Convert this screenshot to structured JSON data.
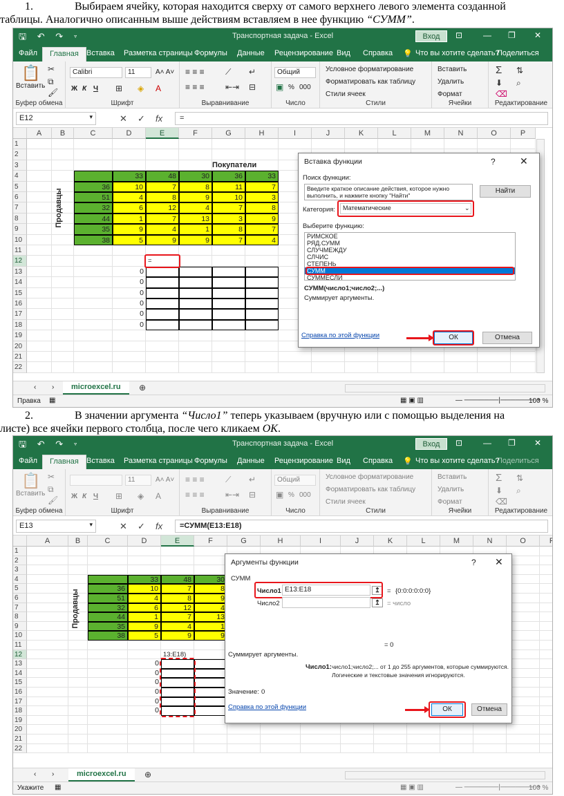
{
  "text1": {
    "num": "1.",
    "line1": "Выбираем ячейку, которая находится сверху от самого верхнего левого элемента созданной",
    "line2_pre": "таблицы. Аналогично описанным выше действиям вставляем в нее функцию ",
    "line2_fn": "“СУММ”",
    "line2_post": "."
  },
  "text2": {
    "num": "2.",
    "line1_pre": "В значении аргумента ",
    "line1_arg": "“Число1”",
    "line1_post": " теперь указываем (вручную или с помощью выделения на",
    "line2_pre": "листе) все ячейки первого столбца, после чего кликаем ",
    "line2_ok": "OK",
    "line2_post": "."
  },
  "window": {
    "title": "Транспортная задача - Excel",
    "login": "Вход",
    "qat": "🖫 ↶ ↷ ▿",
    "min": "—",
    "restore": "❐",
    "close": "✕",
    "ribbon_opts": "⊡"
  },
  "tabs": [
    "Файл",
    "Главная",
    "Вставка",
    "Разметка страницы",
    "Формулы",
    "Данные",
    "Рецензирование",
    "Вид",
    "Справка",
    "Что вы хотите сделать?",
    "Поделиться"
  ],
  "ribbon": {
    "paste": "Вставить",
    "clipboard": "Буфер обмена",
    "font": "Шрифт",
    "font_name": "Calibri",
    "font_size": "11",
    "alignment": "Выравнивание",
    "number": "Число",
    "number_format": "Общий",
    "cond_format": "Условное форматирование",
    "format_table": "Форматировать как таблицу",
    "cell_styles": "Стили ячеек",
    "styles": "Стили",
    "insert": "Вставить",
    "delete": "Удалить",
    "format": "Формат",
    "cells": "Ячейки",
    "editing": "Редактирование",
    "bold": "Ж",
    "italic": "К",
    "underline": "Ч",
    "percent": "%",
    "thousands": "000",
    "sigma": "Σ"
  },
  "shot1": {
    "cell_ref": "E12",
    "formula": "=",
    "mode": "Правка",
    "zoom": "100 %"
  },
  "shot2": {
    "cell_ref": "E13",
    "formula": "=СУММ(E13:E18)",
    "mode": "Укажите",
    "zoom": "100 %"
  },
  "columns": [
    "A",
    "B",
    "C",
    "D",
    "E",
    "F",
    "G",
    "H",
    "I",
    "J",
    "K",
    "L",
    "M",
    "N",
    "O",
    "P"
  ],
  "rows": [
    "1",
    "2",
    "3",
    "4",
    "5",
    "6",
    "7",
    "8",
    "9",
    "10",
    "11",
    "12",
    "13",
    "14",
    "15",
    "16",
    "17",
    "18",
    "19",
    "20",
    "21",
    "22"
  ],
  "sheet": {
    "tab": "microexcel.ru",
    "buyers": "Покупатели",
    "sellers": "Продавцы",
    "header_row": [
      "33",
      "48",
      "30",
      "36",
      "33"
    ],
    "supply": [
      "36",
      "51",
      "32",
      "44",
      "35",
      "38"
    ],
    "matrix": [
      [
        "10",
        "7",
        "8",
        "11",
        "7"
      ],
      [
        "4",
        "8",
        "9",
        "10",
        "3"
      ],
      [
        "6",
        "12",
        "4",
        "7",
        "8"
      ],
      [
        "1",
        "7",
        "13",
        "3",
        "9"
      ],
      [
        "9",
        "4",
        "1",
        "8",
        "7"
      ],
      [
        "5",
        "9",
        "9",
        "7",
        "4"
      ]
    ],
    "zeros": [
      "0",
      "0",
      "0",
      "0",
      "0",
      "0"
    ],
    "e12_1": "=",
    "e12_2": "13:E18)"
  },
  "dialog1": {
    "title": "Вставка функции",
    "help": "?",
    "close": "✕",
    "search_label": "Поиск функции:",
    "search_text": "Введите краткое описание действия, которое нужно выполнить, и нажмите кнопку \"Найти\"",
    "find": "Найти",
    "category_label": "Категория:",
    "category": "Математические",
    "select_label": "Выберите функцию:",
    "functions": [
      "РИМСКОЕ",
      "РЯД.СУММ",
      "СЛУЧМЕЖДУ",
      "СЛЧИС",
      "СТЕПЕНЬ",
      "СУММ",
      "СУММЕСЛИ"
    ],
    "selected": "СУММ",
    "signature": "СУММ(число1;число2;...)",
    "description": "Суммирует аргументы.",
    "help_link": "Справка по этой функции",
    "ok": "ОК",
    "cancel": "Отмена"
  },
  "dialog2": {
    "title": "Аргументы функции",
    "help": "?",
    "close": "✕",
    "fn": "СУММ",
    "arg1_label": "Число1",
    "arg1_value": "E13:E18",
    "arg1_result": "{0:0:0:0:0:0}",
    "arg2_label": "Число2",
    "arg2_result": "= число",
    "equals": "=",
    "total": "= 0",
    "description": "Суммирует аргументы.",
    "arg_desc_label": "Число1:",
    "arg_desc": "число1;число2;... от 1 до 255 аргументов, которые суммируются.",
    "arg_desc2": "Логические и текстовые значения игнорируются.",
    "value_label": "Значение:",
    "value": "0",
    "help_link": "Справка по этой функции",
    "ok": "ОК",
    "cancel": "Отмена"
  }
}
